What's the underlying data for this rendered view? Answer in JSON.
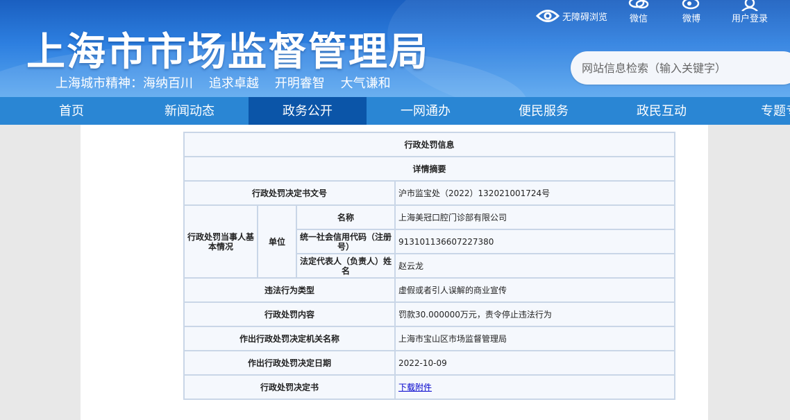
{
  "header": {
    "title": "上海市市场监督管理局",
    "slogan": "上海城市精神：海纳百川    追求卓越    开明睿智    大气谦和",
    "top_links": {
      "accessibility": "无障碍浏览",
      "weixin": "微信",
      "weibo": "微博",
      "login": "用户登录"
    },
    "search": {
      "placeholder": "网站信息检索（输入关键字）"
    }
  },
  "nav": {
    "items": [
      "首页",
      "新闻动态",
      "政务公开",
      "一网通办",
      "便民服务",
      "政民互动",
      "专题专"
    ],
    "active": "政务公开"
  },
  "record": {
    "title": "行政处罚信息",
    "subtitle": "详情摘要",
    "rows": {
      "doc_no_label": "行政处罚决定书文号",
      "doc_no": "沪市监宝处（2022）132021001724号",
      "party_label": "行政处罚当事人基本情况",
      "unit_label": "单位",
      "name_label": "名称",
      "name": "上海美冠口腔门诊部有限公司",
      "credit_label": "统一社会信用代码（注册号）",
      "credit": "913101136607227380",
      "legal_label": "法定代表人（负责人）姓名",
      "legal": "赵云龙",
      "type_label": "违法行为类型",
      "type": "虚假或者引人误解的商业宣传",
      "content_label": "行政处罚内容",
      "content": "罚款30.000000万元，责令停止违法行为",
      "org_label": "作出行政处罚决定机关名称",
      "org": "上海市宝山区市场监督管理局",
      "date_label": "作出行政处罚决定日期",
      "date": "2022-10-09",
      "doc_label": "行政处罚决定书",
      "doc_link": "下载附件"
    }
  },
  "colors": {
    "banner": "#2d7fe0",
    "nav": "#2a86d4",
    "nav_active": "#0b55a8",
    "table_border": "#c9d6e7"
  }
}
